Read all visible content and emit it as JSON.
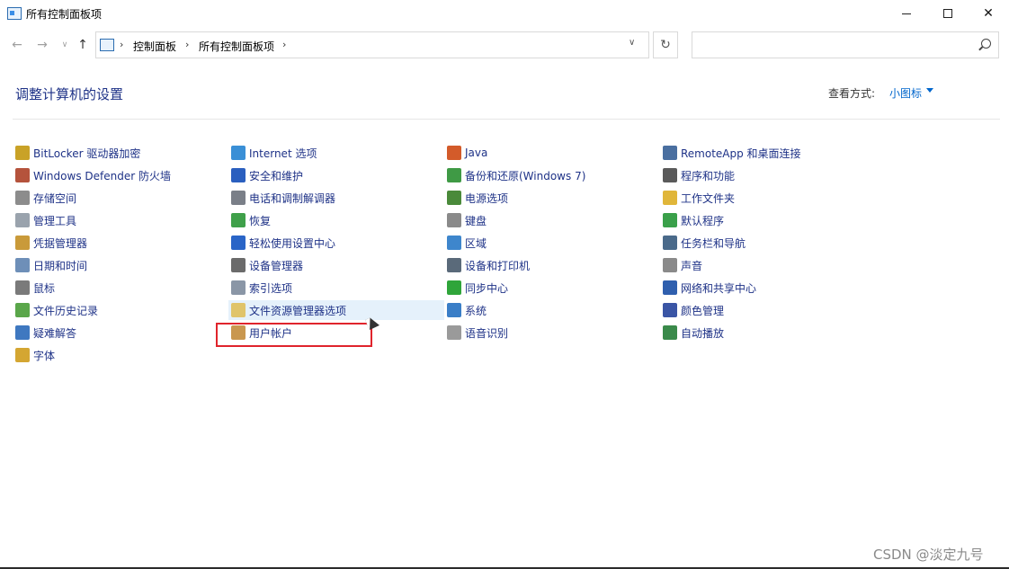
{
  "window": {
    "title": "所有控制面板项",
    "min_glyph": "—",
    "max_glyph": "☐",
    "close_glyph": "✕"
  },
  "nav": {
    "back": "←",
    "forward": "→",
    "dropdown": "∨",
    "up": "↑",
    "refresh": "↻",
    "sep": "›",
    "addr_dropdown": "∨",
    "breadcrumbs": [
      "控制面板",
      "所有控制面板项"
    ]
  },
  "search": {
    "placeholder": ""
  },
  "header": {
    "title": "调整计算机的设置",
    "view_by_label": "查看方式:",
    "view_by_value": "小图标"
  },
  "items": [
    [
      {
        "label": "BitLocker 驱动器加密",
        "icon": "bitlocker-icon",
        "color": "#c9a227"
      },
      {
        "label": "Windows Defender 防火墙",
        "icon": "firewall-icon",
        "color": "#b5533c"
      },
      {
        "label": "存储空间",
        "icon": "storage-spaces-icon",
        "color": "#8c8c8c"
      },
      {
        "label": "管理工具",
        "icon": "admin-tools-icon",
        "color": "#9aa3ad"
      },
      {
        "label": "凭据管理器",
        "icon": "credential-manager-icon",
        "color": "#c99a3a"
      },
      {
        "label": "日期和时间",
        "icon": "date-time-icon",
        "color": "#6e8fb8"
      },
      {
        "label": "鼠标",
        "icon": "mouse-icon",
        "color": "#7a7a7a"
      },
      {
        "label": "文件历史记录",
        "icon": "file-history-icon",
        "color": "#5aa64a"
      },
      {
        "label": "疑难解答",
        "icon": "troubleshooting-icon",
        "color": "#3f78c0"
      },
      {
        "label": "字体",
        "icon": "fonts-icon",
        "color": "#d4a632"
      }
    ],
    [
      {
        "label": "Internet 选项",
        "icon": "internet-options-icon",
        "color": "#3a8fd6"
      },
      {
        "label": "安全和维护",
        "icon": "security-maintenance-icon",
        "color": "#2a5fbf"
      },
      {
        "label": "电话和调制解调器",
        "icon": "phone-modem-icon",
        "color": "#7a7f88"
      },
      {
        "label": "恢复",
        "icon": "recovery-icon",
        "color": "#3fa04a"
      },
      {
        "label": "轻松使用设置中心",
        "icon": "ease-of-access-icon",
        "color": "#2a65c7"
      },
      {
        "label": "设备管理器",
        "icon": "device-manager-icon",
        "color": "#6b6b6b"
      },
      {
        "label": "索引选项",
        "icon": "indexing-options-icon",
        "color": "#8a96a6"
      },
      {
        "label": "文件资源管理器选项",
        "icon": "file-explorer-options-icon",
        "color": "#e0c46a"
      },
      {
        "label": "用户帐户",
        "icon": "user-accounts-icon",
        "color": "#c9974f"
      }
    ],
    [
      {
        "label": "Java",
        "icon": "java-icon",
        "color": "#d35b2a"
      },
      {
        "label": "备份和还原(Windows 7)",
        "icon": "backup-restore-icon",
        "color": "#3f9a45"
      },
      {
        "label": "电源选项",
        "icon": "power-options-icon",
        "color": "#4a8a3a"
      },
      {
        "label": "键盘",
        "icon": "keyboard-icon",
        "color": "#8a8a8a"
      },
      {
        "label": "区域",
        "icon": "region-icon",
        "color": "#3e86cc"
      },
      {
        "label": "设备和打印机",
        "icon": "devices-printers-icon",
        "color": "#5a6a7a"
      },
      {
        "label": "同步中心",
        "icon": "sync-center-icon",
        "color": "#2fa53a"
      },
      {
        "label": "系统",
        "icon": "system-icon",
        "color": "#3a7ec7"
      },
      {
        "label": "语音识别",
        "icon": "speech-recognition-icon",
        "color": "#9a9a9a"
      }
    ],
    [
      {
        "label": "RemoteApp 和桌面连接",
        "icon": "remoteapp-icon",
        "color": "#4a6fa0"
      },
      {
        "label": "程序和功能",
        "icon": "programs-features-icon",
        "color": "#5a5a5a"
      },
      {
        "label": "工作文件夹",
        "icon": "work-folders-icon",
        "color": "#e0b63a"
      },
      {
        "label": "默认程序",
        "icon": "default-programs-icon",
        "color": "#3aa04a"
      },
      {
        "label": "任务栏和导航",
        "icon": "taskbar-navigation-icon",
        "color": "#4a6a8a"
      },
      {
        "label": "声音",
        "icon": "sound-icon",
        "color": "#8a8a8a"
      },
      {
        "label": "网络和共享中心",
        "icon": "network-sharing-icon",
        "color": "#2f5fae"
      },
      {
        "label": "颜色管理",
        "icon": "color-management-icon",
        "color": "#3a55a5"
      },
      {
        "label": "自动播放",
        "icon": "autoplay-icon",
        "color": "#3a8a4a"
      }
    ]
  ],
  "watermark": "CSDN @淡定九号"
}
